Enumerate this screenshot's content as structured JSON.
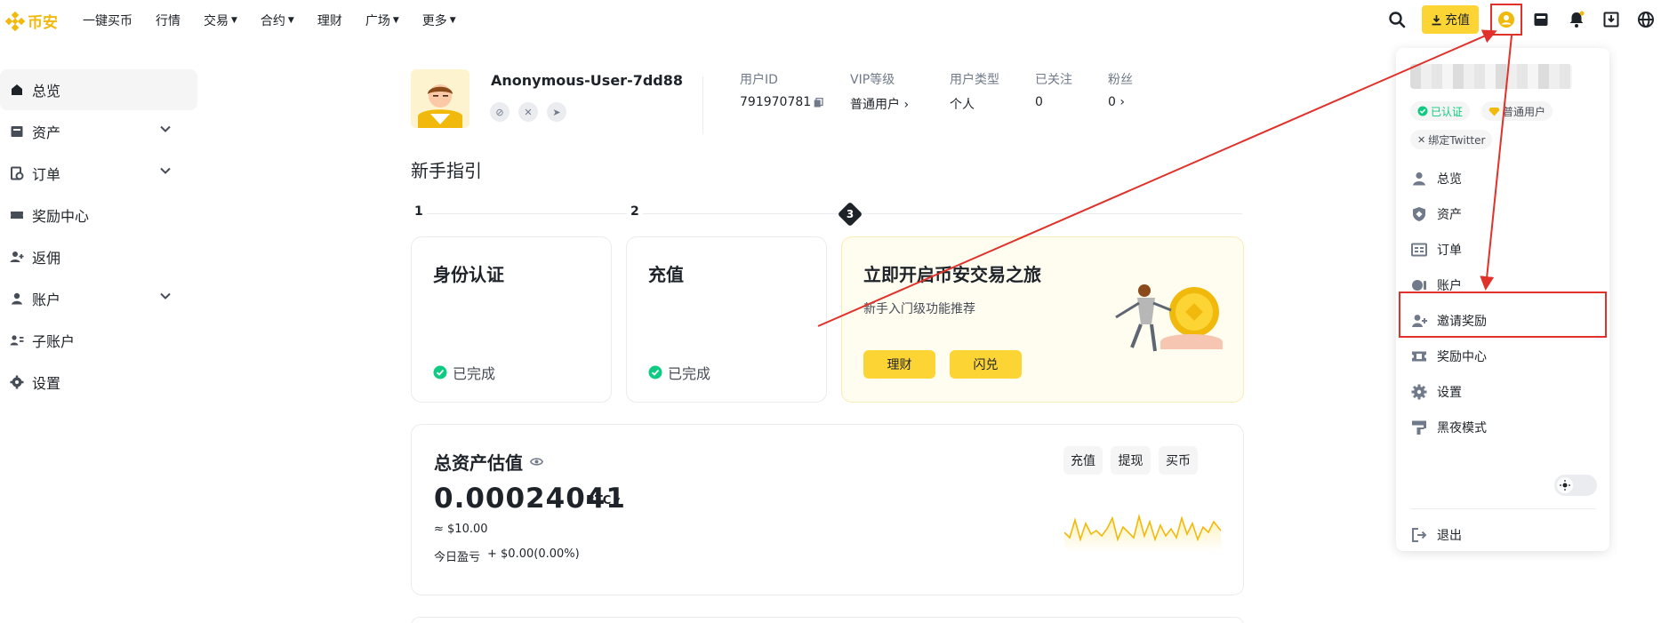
{
  "brand": {
    "name": "币安",
    "color": "#f0b90b"
  },
  "nav": [
    {
      "label": "一键买币",
      "has_dropdown": false
    },
    {
      "label": "行情",
      "has_dropdown": false
    },
    {
      "label": "交易",
      "has_dropdown": true
    },
    {
      "label": "合约",
      "has_dropdown": true
    },
    {
      "label": "理财",
      "has_dropdown": false
    },
    {
      "label": "广场",
      "has_dropdown": true
    },
    {
      "label": "更多",
      "has_dropdown": true
    }
  ],
  "topbar": {
    "deposit_label": "充值",
    "icons": [
      "search-icon",
      "user-avatar-icon",
      "wallet-icon",
      "bell-icon",
      "download-icon",
      "globe-icon"
    ]
  },
  "sidebar": [
    {
      "label": "总览",
      "icon": "home-icon",
      "active": true,
      "expandable": false
    },
    {
      "label": "资产",
      "icon": "wallet-icon",
      "active": false,
      "expandable": true
    },
    {
      "label": "订单",
      "icon": "order-icon",
      "active": false,
      "expandable": true
    },
    {
      "label": "奖励中心",
      "icon": "ticket-icon",
      "active": false,
      "expandable": false
    },
    {
      "label": "返佣",
      "icon": "user-plus-icon",
      "active": false,
      "expandable": false
    },
    {
      "label": "账户",
      "icon": "user-icon",
      "active": false,
      "expandable": true
    },
    {
      "label": "子账户",
      "icon": "sub-account-icon",
      "active": false,
      "expandable": false
    },
    {
      "label": "设置",
      "icon": "gear-icon",
      "active": false,
      "expandable": false
    }
  ],
  "profile": {
    "name": "Anonymous-User-7dd88",
    "stats": [
      {
        "label": "用户ID",
        "value": "791970781"
      },
      {
        "label": "VIP等级",
        "value": "普通用户"
      },
      {
        "label": "用户类型",
        "value": "个人"
      },
      {
        "label": "已关注",
        "value": "0"
      },
      {
        "label": "粉丝",
        "value": "0"
      }
    ]
  },
  "guide": {
    "title": "新手指引",
    "steps": [
      "1",
      "2",
      "3"
    ],
    "cards": [
      {
        "title": "身份认证",
        "status": "已完成"
      },
      {
        "title": "充值",
        "status": "已完成"
      }
    ],
    "journey": {
      "title": "立即开启币安交易之旅",
      "subtitle": "新手入门级功能推荐",
      "buttons": [
        "理财",
        "闪兑"
      ]
    }
  },
  "assets": {
    "title": "总资产估值",
    "value": "0.00024041",
    "unit": "BTC",
    "usd": "≈ $10.00",
    "pnl_label": "今日盈亏",
    "pnl_value": "+ $0.00(0.00%)",
    "buttons": [
      "充值",
      "提现",
      "买币"
    ]
  },
  "dropdown": {
    "badges": [
      "已认证",
      "普通用户",
      "绑定Twitter"
    ],
    "items": [
      {
        "label": "总览",
        "icon": "user-icon"
      },
      {
        "label": "资产",
        "icon": "shield-icon"
      },
      {
        "label": "订单",
        "icon": "order-list-icon"
      },
      {
        "label": "账户",
        "icon": "account-card-icon"
      },
      {
        "label": "邀请奖励",
        "icon": "user-plus-icon"
      },
      {
        "label": "奖励中心",
        "icon": "ticket-icon"
      },
      {
        "label": "设置",
        "icon": "gear-icon"
      },
      {
        "label": "黑夜模式",
        "icon": "brush-icon"
      },
      {
        "label": "退出",
        "icon": "logout-icon"
      }
    ]
  },
  "colors": {
    "accent": "#fcd535",
    "success": "#0ecb81",
    "annotation": "#e0312b"
  }
}
